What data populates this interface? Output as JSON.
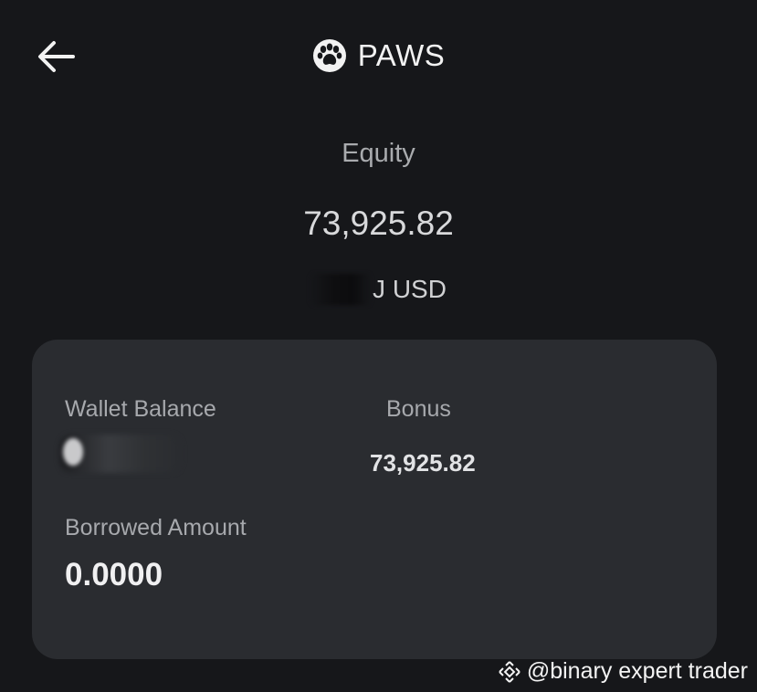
{
  "header": {
    "back_icon": "arrow-left-icon",
    "title": "PAWS",
    "coin_icon": "paw-icon"
  },
  "summary": {
    "equity_label": "Equity",
    "equity_value": "73,925.82",
    "usd_value_visible": "J USD"
  },
  "card": {
    "wallet_balance_label": "Wallet Balance",
    "wallet_balance_value_redacted": true,
    "bonus_label": "Bonus",
    "bonus_value": "73,925.82",
    "borrowed_label": "Borrowed Amount",
    "borrowed_value": "0.0000"
  },
  "watermark": {
    "logo_icon": "binance-diamond-icon",
    "text": "@binary expert trader"
  },
  "colors": {
    "background": "#16171a",
    "card_background": "#2a2c30",
    "primary_text": "#f0f0f1",
    "secondary_text": "#a7a9ad"
  }
}
